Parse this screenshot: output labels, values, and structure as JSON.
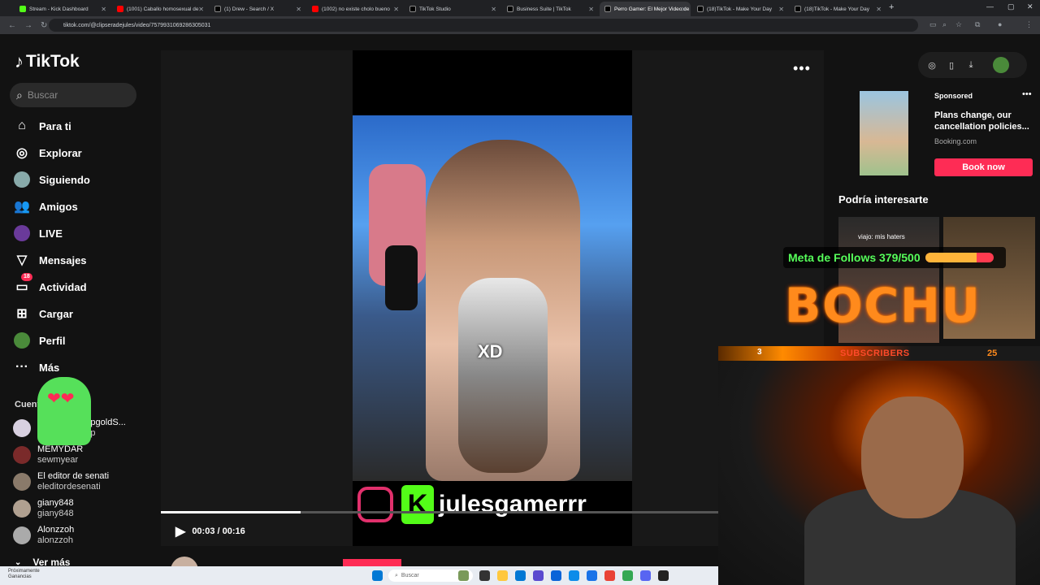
{
  "browser": {
    "tabs": [
      {
        "label": "Stream - Kick Dashboard",
        "color": "#53fc18"
      },
      {
        "label": "(1001) Caballo homosexual de",
        "color": "#ff0000"
      },
      {
        "label": "(1) Drew - Search / X",
        "color": "#000000"
      },
      {
        "label": "(1002) no existe cholo bueno",
        "color": "#ff0000"
      },
      {
        "label": "TikTok Studio",
        "color": "#000000"
      },
      {
        "label": "Business Suite | TikTok",
        "color": "#000000"
      },
      {
        "label": "Perro Gamer: El Mejor Video de",
        "color": "#000000"
      },
      {
        "label": "(18)TikTok - Make Your Day",
        "color": "#000000"
      },
      {
        "label": "(18)TikTok - Make Your Day",
        "color": "#000000"
      }
    ],
    "url": "tiktok.com/@clipseradejules/video/7579931069286305031"
  },
  "sidebar": {
    "logo": "TikTok",
    "search_placeholder": "Buscar",
    "nav": [
      {
        "label": "Para ti",
        "icon": "home-icon"
      },
      {
        "label": "Explorar",
        "icon": "compass-icon"
      },
      {
        "label": "Siguiendo",
        "icon": "following-avatar-icon"
      },
      {
        "label": "Amigos",
        "icon": "friends-icon"
      },
      {
        "label": "LIVE",
        "icon": "live-icon"
      },
      {
        "label": "Mensajes",
        "icon": "paper-plane-icon"
      },
      {
        "label": "Actividad",
        "icon": "inbox-icon",
        "badge": "18"
      },
      {
        "label": "Cargar",
        "icon": "plus-square-icon"
      },
      {
        "label": "Perfil",
        "icon": "profile-avatar-icon"
      },
      {
        "label": "Más",
        "icon": "more-dots-icon"
      }
    ],
    "accounts_heading": "Cuentas seguidas",
    "accounts": [
      {
        "name": "mona.goldshipgoldS...",
        "handle": "mona.goldship"
      },
      {
        "name": "MEMYDAR",
        "handle": "sewmyear"
      },
      {
        "name": "El editor de senati",
        "handle": "eleditordesenati"
      },
      {
        "name": "giany848",
        "handle": "giany848"
      },
      {
        "name": "Alonzzoh",
        "handle": "alonzzoh"
      }
    ],
    "see_more": "Ver más"
  },
  "video": {
    "overlay_text": "XD",
    "watermark": "julesgamerrr",
    "current_time": "00:03",
    "duration": "00:16",
    "time_display": "00:03 / 00:16",
    "progress": 0.25,
    "author": "clipseradejules"
  },
  "ad": {
    "sponsored_label": "Sponsored",
    "text": "Plans change, our cancellation policies...",
    "source": "Booking.com",
    "cta": "Book now"
  },
  "recommendations": {
    "heading": "Podría interesarte",
    "items": [
      {
        "caption": "viajo: mis haters"
      }
    ]
  },
  "stream_overlay": {
    "follow_goal": "Meta de Follows 379/500",
    "follow_current": 379,
    "follow_target": 500,
    "brand": "BOCHU",
    "subs_left": "3",
    "subs_label": "SUBSCRIBERS",
    "subs_right": "25"
  },
  "taskbar": {
    "search_placeholder": "Buscar",
    "weather_line1": "Próximamente",
    "weather_line2": "Ganancias"
  }
}
